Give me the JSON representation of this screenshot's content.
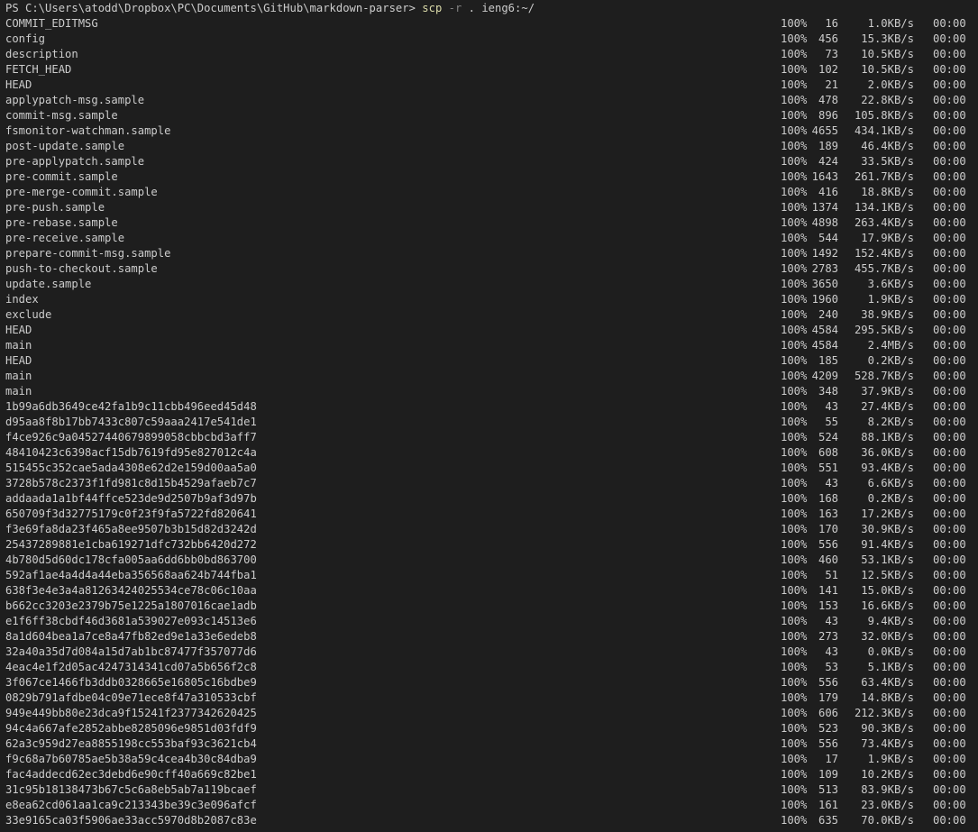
{
  "prompt": {
    "text": "PS C:\\Users\\atodd\\Dropbox\\PC\\Documents\\GitHub\\markdown-parser> ",
    "command": "scp",
    "flag": "-r",
    "args": ". ieng6:~/"
  },
  "colors": {
    "background": "#1e1e1e",
    "text": "#cccccc",
    "command": "#dcdcaa",
    "flag": "#808080"
  },
  "transfers": [
    {
      "name": "COMMIT_EDITMSG",
      "pct": "100%",
      "size": "16",
      "speed": "1.0KB/s",
      "eta": "00:00"
    },
    {
      "name": "config",
      "pct": "100%",
      "size": "456",
      "speed": "15.3KB/s",
      "eta": "00:00"
    },
    {
      "name": "description",
      "pct": "100%",
      "size": "73",
      "speed": "10.5KB/s",
      "eta": "00:00"
    },
    {
      "name": "FETCH_HEAD",
      "pct": "100%",
      "size": "102",
      "speed": "10.5KB/s",
      "eta": "00:00"
    },
    {
      "name": "HEAD",
      "pct": "100%",
      "size": "21",
      "speed": "2.0KB/s",
      "eta": "00:00"
    },
    {
      "name": "applypatch-msg.sample",
      "pct": "100%",
      "size": "478",
      "speed": "22.8KB/s",
      "eta": "00:00"
    },
    {
      "name": "commit-msg.sample",
      "pct": "100%",
      "size": "896",
      "speed": "105.8KB/s",
      "eta": "00:00"
    },
    {
      "name": "fsmonitor-watchman.sample",
      "pct": "100%",
      "size": "4655",
      "speed": "434.1KB/s",
      "eta": "00:00"
    },
    {
      "name": "post-update.sample",
      "pct": "100%",
      "size": "189",
      "speed": "46.4KB/s",
      "eta": "00:00"
    },
    {
      "name": "pre-applypatch.sample",
      "pct": "100%",
      "size": "424",
      "speed": "33.5KB/s",
      "eta": "00:00"
    },
    {
      "name": "pre-commit.sample",
      "pct": "100%",
      "size": "1643",
      "speed": "261.7KB/s",
      "eta": "00:00"
    },
    {
      "name": "pre-merge-commit.sample",
      "pct": "100%",
      "size": "416",
      "speed": "18.8KB/s",
      "eta": "00:00"
    },
    {
      "name": "pre-push.sample",
      "pct": "100%",
      "size": "1374",
      "speed": "134.1KB/s",
      "eta": "00:00"
    },
    {
      "name": "pre-rebase.sample",
      "pct": "100%",
      "size": "4898",
      "speed": "263.4KB/s",
      "eta": "00:00"
    },
    {
      "name": "pre-receive.sample",
      "pct": "100%",
      "size": "544",
      "speed": "17.9KB/s",
      "eta": "00:00"
    },
    {
      "name": "prepare-commit-msg.sample",
      "pct": "100%",
      "size": "1492",
      "speed": "152.4KB/s",
      "eta": "00:00"
    },
    {
      "name": "push-to-checkout.sample",
      "pct": "100%",
      "size": "2783",
      "speed": "455.7KB/s",
      "eta": "00:00"
    },
    {
      "name": "update.sample",
      "pct": "100%",
      "size": "3650",
      "speed": "3.6KB/s",
      "eta": "00:00"
    },
    {
      "name": "index",
      "pct": "100%",
      "size": "1960",
      "speed": "1.9KB/s",
      "eta": "00:00"
    },
    {
      "name": "exclude",
      "pct": "100%",
      "size": "240",
      "speed": "38.9KB/s",
      "eta": "00:00"
    },
    {
      "name": "HEAD",
      "pct": "100%",
      "size": "4584",
      "speed": "295.5KB/s",
      "eta": "00:00"
    },
    {
      "name": "main",
      "pct": "100%",
      "size": "4584",
      "speed": "2.4MB/s",
      "eta": "00:00"
    },
    {
      "name": "HEAD",
      "pct": "100%",
      "size": "185",
      "speed": "0.2KB/s",
      "eta": "00:00"
    },
    {
      "name": "main",
      "pct": "100%",
      "size": "4209",
      "speed": "528.7KB/s",
      "eta": "00:00"
    },
    {
      "name": "main",
      "pct": "100%",
      "size": "348",
      "speed": "37.9KB/s",
      "eta": "00:00"
    },
    {
      "name": "1b99a6db3649ce42fa1b9c11cbb496eed45d48",
      "pct": "100%",
      "size": "43",
      "speed": "27.4KB/s",
      "eta": "00:00"
    },
    {
      "name": "d95aa8f8b17bb7433c807c59aaa2417e541de1",
      "pct": "100%",
      "size": "55",
      "speed": "8.2KB/s",
      "eta": "00:00"
    },
    {
      "name": "f4ce926c9a04527440679899058cbbcbd3aff7",
      "pct": "100%",
      "size": "524",
      "speed": "88.1KB/s",
      "eta": "00:00"
    },
    {
      "name": "48410423c6398acf15db7619fd95e827012c4a",
      "pct": "100%",
      "size": "608",
      "speed": "36.0KB/s",
      "eta": "00:00"
    },
    {
      "name": "515455c352cae5ada4308e62d2e159d00aa5a0",
      "pct": "100%",
      "size": "551",
      "speed": "93.4KB/s",
      "eta": "00:00"
    },
    {
      "name": "3728b578c2373f1fd981c8d15b4529afaeb7c7",
      "pct": "100%",
      "size": "43",
      "speed": "6.6KB/s",
      "eta": "00:00"
    },
    {
      "name": "addaada1a1bf44ffce523de9d2507b9af3d97b",
      "pct": "100%",
      "size": "168",
      "speed": "0.2KB/s",
      "eta": "00:00"
    },
    {
      "name": "650709f3d32775179c0f23f9fa5722fd820641",
      "pct": "100%",
      "size": "163",
      "speed": "17.2KB/s",
      "eta": "00:00"
    },
    {
      "name": "f3e69fa8da23f465a8ee9507b3b15d82d3242d",
      "pct": "100%",
      "size": "170",
      "speed": "30.9KB/s",
      "eta": "00:00"
    },
    {
      "name": "25437289881e1cba619271dfc732bb6420d272",
      "pct": "100%",
      "size": "556",
      "speed": "91.4KB/s",
      "eta": "00:00"
    },
    {
      "name": "4b780d5d60dc178cfa005aa6dd6bb0bd863700",
      "pct": "100%",
      "size": "460",
      "speed": "53.1KB/s",
      "eta": "00:00"
    },
    {
      "name": "592af1ae4a4d4a44eba356568aa624b744fba1",
      "pct": "100%",
      "size": "51",
      "speed": "12.5KB/s",
      "eta": "00:00"
    },
    {
      "name": "638f3e4e3a4a81263424025534ce78c06c10aa",
      "pct": "100%",
      "size": "141",
      "speed": "15.0KB/s",
      "eta": "00:00"
    },
    {
      "name": "b662cc3203e2379b75e1225a1807016cae1adb",
      "pct": "100%",
      "size": "153",
      "speed": "16.6KB/s",
      "eta": "00:00"
    },
    {
      "name": "e1f6ff38cbdf46d3681a539027e093c14513e6",
      "pct": "100%",
      "size": "43",
      "speed": "9.4KB/s",
      "eta": "00:00"
    },
    {
      "name": "8a1d604bea1a7ce8a47fb82ed9e1a33e6edeb8",
      "pct": "100%",
      "size": "273",
      "speed": "32.0KB/s",
      "eta": "00:00"
    },
    {
      "name": "32a40a35d7d084a15d7ab1bc87477f357077d6",
      "pct": "100%",
      "size": "43",
      "speed": "0.0KB/s",
      "eta": "00:00"
    },
    {
      "name": "4eac4e1f2d05ac4247314341cd07a5b656f2c8",
      "pct": "100%",
      "size": "53",
      "speed": "5.1KB/s",
      "eta": "00:00"
    },
    {
      "name": "3f067ce1466fb3ddb0328665e16805c16bdbe9",
      "pct": "100%",
      "size": "556",
      "speed": "63.4KB/s",
      "eta": "00:00"
    },
    {
      "name": "0829b791afdbe04c09e71ece8f47a310533cbf",
      "pct": "100%",
      "size": "179",
      "speed": "14.8KB/s",
      "eta": "00:00"
    },
    {
      "name": "949e449bb80e23dca9f15241f2377342620425",
      "pct": "100%",
      "size": "606",
      "speed": "212.3KB/s",
      "eta": "00:00"
    },
    {
      "name": "94c4a667afe2852abbe8285096e9851d03fdf9",
      "pct": "100%",
      "size": "523",
      "speed": "90.3KB/s",
      "eta": "00:00"
    },
    {
      "name": "62a3c959d27ea8855198cc553baf93c3621cb4",
      "pct": "100%",
      "size": "556",
      "speed": "73.4KB/s",
      "eta": "00:00"
    },
    {
      "name": "f9c68a7b60785ae5b38a59c4cea4b30c84dba9",
      "pct": "100%",
      "size": "17",
      "speed": "1.9KB/s",
      "eta": "00:00"
    },
    {
      "name": "fac4addecd62ec3debd6e90cff40a669c82be1",
      "pct": "100%",
      "size": "109",
      "speed": "10.2KB/s",
      "eta": "00:00"
    },
    {
      "name": "31c95b18138473b67c5c6a8eb5ab7a119bcaef",
      "pct": "100%",
      "size": "513",
      "speed": "83.9KB/s",
      "eta": "00:00"
    },
    {
      "name": "e8ea62cd061aa1ca9c213343be39c3e096afcf",
      "pct": "100%",
      "size": "161",
      "speed": "23.0KB/s",
      "eta": "00:00"
    },
    {
      "name": "33e9165ca03f5906ae33acc5970d8b2087c83e",
      "pct": "100%",
      "size": "635",
      "speed": "70.0KB/s",
      "eta": "00:00"
    }
  ]
}
